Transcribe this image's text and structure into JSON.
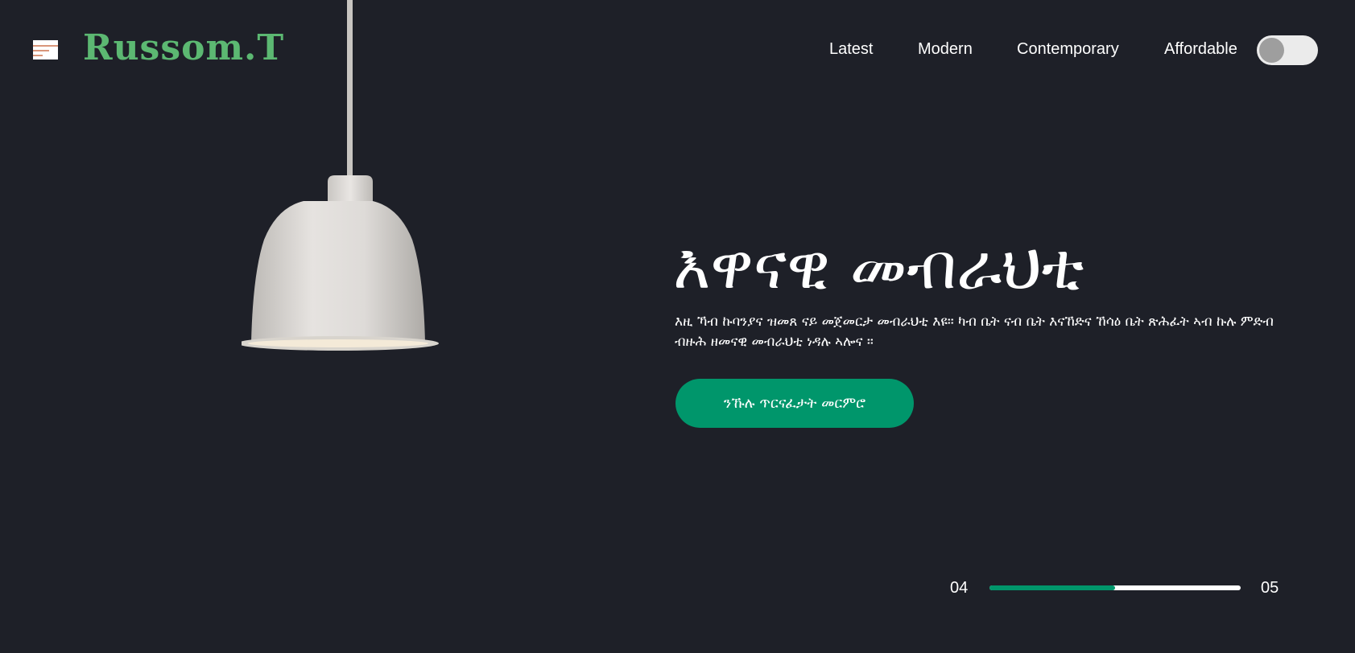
{
  "header": {
    "menu_icon": "hamburger-menu-icon",
    "logo_text": "Russom.T",
    "nav": [
      {
        "label": "Latest"
      },
      {
        "label": "Modern"
      },
      {
        "label": "Contemporary"
      },
      {
        "label": "Affordable"
      }
    ],
    "theme_toggle": {
      "state": "off"
    }
  },
  "hero": {
    "image": "pendant-lamp",
    "title": "እዋናዊ መብራህቲ",
    "description": "እዚ ኻብ ኩባንያና ዝመጸ ናይ መጀመርታ መብራህቲ እዩ። ካብ ቤት ናብ ቤት እናኸድና ኸሳዕ ቤት ጽሕፈት ኣብ ኩሉ ምድብ ብዙሕ ዘመናዊ መብራህቲ ነዳሉ ኣሎና ።",
    "cta_label": "ንኹሉ ጥርናፈታት መርምሮ"
  },
  "slider": {
    "current": "04",
    "total": "05",
    "progress_fraction": 0.5
  },
  "colors": {
    "background": "#1e2028",
    "accent": "#00966b",
    "logo": "#5cb872",
    "text": "#ffffff"
  }
}
